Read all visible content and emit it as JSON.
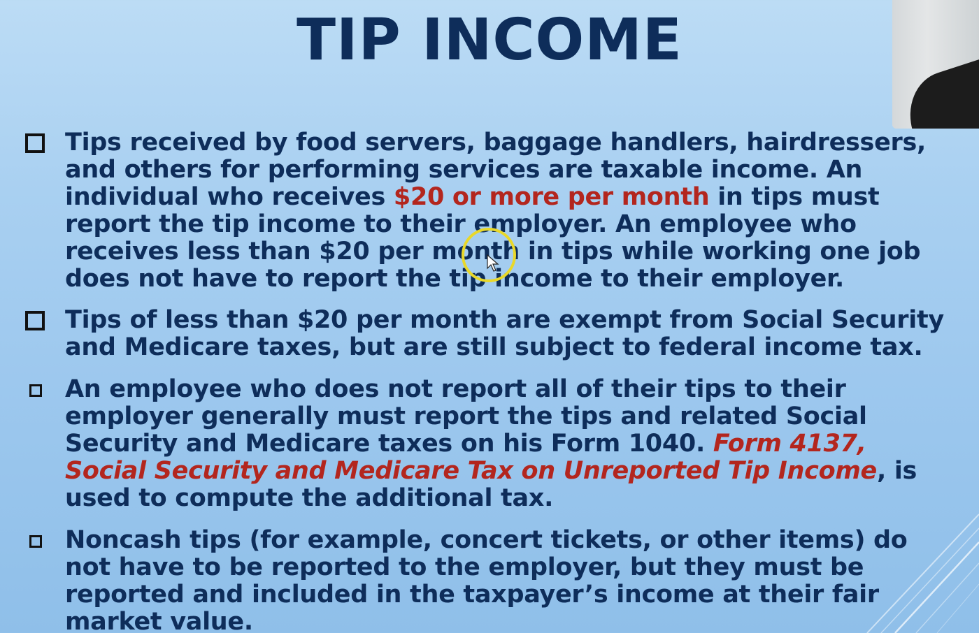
{
  "slide": {
    "title": "TIP INCOME"
  },
  "bullets": [
    {
      "before": "Tips received by food servers, baggage handlers, hairdressers, and others for performing services are taxable income. An individual who receives ",
      "highlight": "$20 or more per month",
      "after": " in tips must report the tip income to their employer. An employee who receives less than $20 per month in tips while working one job does not have to report the tip income to their employer."
    },
    {
      "text": "Tips of less than $20 per month are exempt from Social Security and Medicare taxes, but are still subject to federal income tax."
    },
    {
      "before": "An employee who does not report all of their tips to their employer generally must report the tips and related Social Security and Medicare taxes on his Form 1040. ",
      "highlight": "Form 4137, Social Security and Medicare Tax on Unreported Tip Income",
      "after": ", is used to compute the additional tax."
    },
    {
      "text": "Noncash tips (for example, concert tickets, or other items) do not have to be reported to the employer, but they must be reported and included in the taxpayer’s income at their fair market value."
    }
  ],
  "colors": {
    "title": "#0e2d5a",
    "body_text": "#0e2d5a",
    "highlight": "#b3261e",
    "cursor_ring": "#e9d82a",
    "background": "#a9d0f1"
  },
  "icons": {
    "bullet": "hollow-square-icon",
    "pointer": "mouse-cursor-icon"
  }
}
